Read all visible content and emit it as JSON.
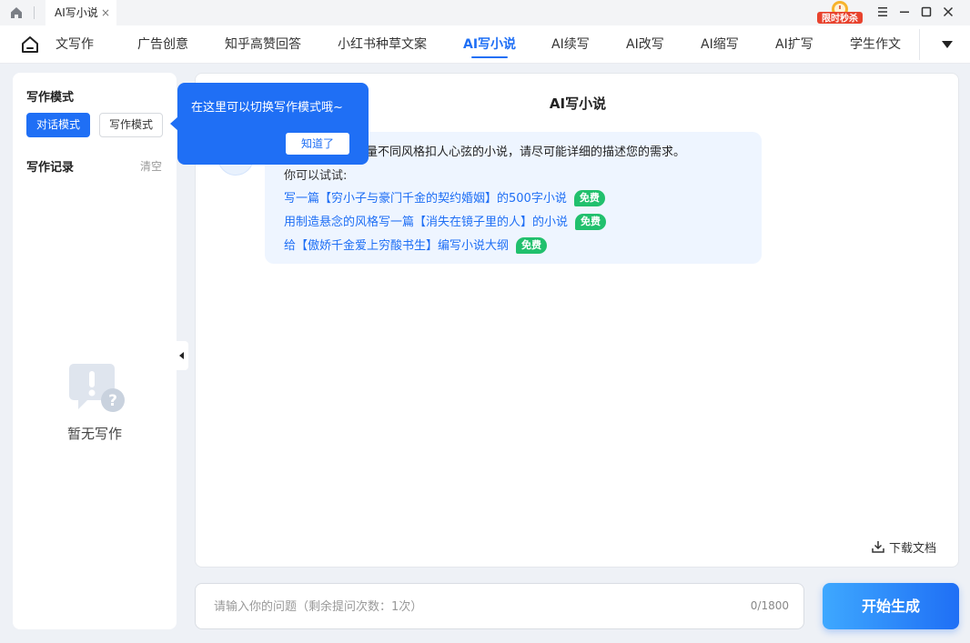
{
  "window": {
    "tab_title": "AI写小说",
    "tab_close": "×",
    "promo_text": "限时秒杀"
  },
  "nav": {
    "items": [
      {
        "label": "文写作"
      },
      {
        "label": "广告创意"
      },
      {
        "label": "知乎高赞回答"
      },
      {
        "label": "小红书种草文案"
      },
      {
        "label": "AI写小说"
      },
      {
        "label": "AI续写"
      },
      {
        "label": "AI改写"
      },
      {
        "label": "AI缩写"
      },
      {
        "label": "AI扩写"
      },
      {
        "label": "学生作文"
      }
    ],
    "active_label": "AI写小说"
  },
  "sidebar": {
    "mode_heading": "写作模式",
    "mode_chat": "对话模式",
    "mode_write": "写作模式",
    "records_heading": "写作记录",
    "clear": "清空",
    "empty_text": "暂无写作"
  },
  "tooltip": {
    "text": "在这里可以切换写作模式哦~",
    "button": "知道了"
  },
  "main": {
    "title": "AI写小说",
    "bubble_text": "吾量不同风格扣人心弦的小说，请尽可能详细的描述您的需求。",
    "try_label": "你可以试试:",
    "suggestions": [
      {
        "text": "写一篇【穷小子与豪门千金的契约婚姻】的500字小说",
        "badge": "免费"
      },
      {
        "text": "用制造悬念的风格写一篇【消失在镜子里的人】的小说",
        "badge": "免费"
      },
      {
        "text": "给【傲娇千金爱上穷酸书生】编写小说大纲",
        "badge": "免费"
      }
    ],
    "download": "下载文档"
  },
  "input": {
    "placeholder": "请输入你的问题（剩余提问次数：1次）",
    "value": "",
    "counter": "0/1800"
  },
  "generate_button": "开始生成",
  "colors": {
    "accent": "#1f6ff5",
    "badge": "#21c06d",
    "bubble_bg": "#eef5ff"
  }
}
